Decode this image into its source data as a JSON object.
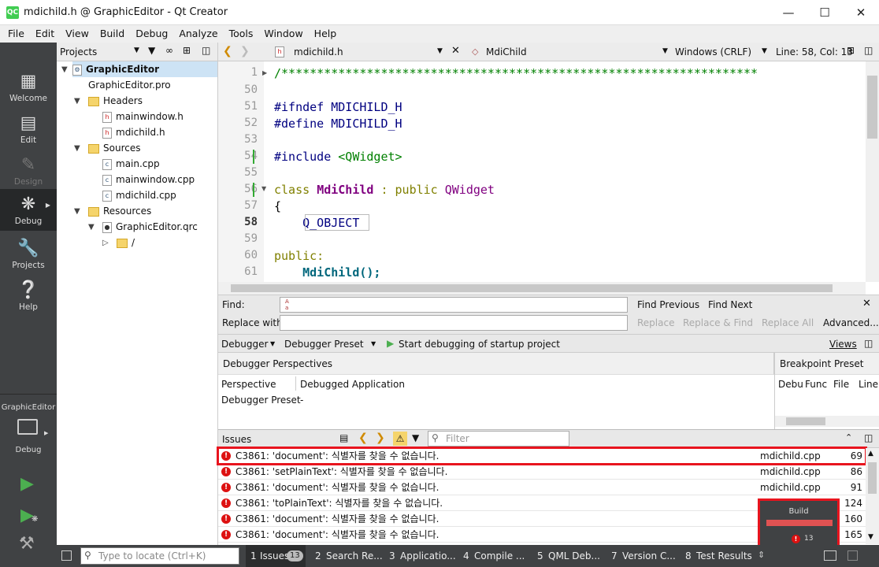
{
  "window": {
    "title": "mdichild.h @ GraphicEditor - Qt Creator",
    "app_icon": "QC"
  },
  "menu": [
    "File",
    "Edit",
    "View",
    "Build",
    "Debug",
    "Analyze",
    "Tools",
    "Window",
    "Help"
  ],
  "modes": [
    {
      "label": "Welcome",
      "icon": "grid-icon"
    },
    {
      "label": "Edit",
      "icon": "document-icon"
    },
    {
      "label": "Design",
      "icon": "pencil-icon"
    },
    {
      "label": "Debug",
      "icon": "bug-icon"
    },
    {
      "label": "Projects",
      "icon": "wrench-icon"
    },
    {
      "label": "Help",
      "icon": "help-icon"
    }
  ],
  "kit": {
    "project": "GraphicEditor",
    "config": "Debug"
  },
  "projects": {
    "header": "Projects",
    "tree": [
      {
        "label": "GraphicEditor"
      },
      {
        "label": "GraphicEditor.pro"
      },
      {
        "label": "Headers"
      },
      {
        "label": "mainwindow.h"
      },
      {
        "label": "mdichild.h"
      },
      {
        "label": "Sources"
      },
      {
        "label": "main.cpp"
      },
      {
        "label": "mainwindow.cpp"
      },
      {
        "label": "mdichild.cpp"
      },
      {
        "label": "Resources"
      },
      {
        "label": "GraphicEditor.qrc"
      },
      {
        "label": "/"
      }
    ]
  },
  "editor": {
    "file": "mdichild.h",
    "symbol": "MdiChild",
    "encoding": "Windows (CRLF)",
    "position": "Line: 58, Col: 13",
    "lines": [
      {
        "n": "1",
        "text": "/*******************************************************************"
      },
      {
        "n": "50",
        "text": ""
      },
      {
        "n": "51",
        "text": "#ifndef MDICHILD_H"
      },
      {
        "n": "52",
        "text": "#define MDICHILD_H"
      },
      {
        "n": "53",
        "text": ""
      },
      {
        "n": "54",
        "text": "#include <QWidget>"
      },
      {
        "n": "55",
        "text": ""
      },
      {
        "n": "56",
        "text": "class MdiChild : public QWidget"
      },
      {
        "n": "57",
        "text": "{"
      },
      {
        "n": "58",
        "text": "    Q_OBJECT"
      },
      {
        "n": "59",
        "text": ""
      },
      {
        "n": "60",
        "text": "public:"
      },
      {
        "n": "61",
        "text": "    MdiChild();"
      }
    ]
  },
  "find": {
    "find_label": "Find:",
    "replace_label": "Replace with:",
    "find_previous": "Find Previous",
    "find_next": "Find Next",
    "replace": "Replace",
    "replace_find": "Replace & Find",
    "replace_all": "Replace All",
    "advanced": "Advanced...",
    "case_icon": "Aa"
  },
  "debugger": {
    "combo1": "Debugger",
    "combo2": "Debugger Preset",
    "start": "Start debugging of startup project",
    "views": "Views",
    "perspectives_title": "Debugger Perspectives",
    "col_perspective": "Perspective",
    "col_app": "Debugged Application",
    "row_preset": "Debugger Preset",
    "row_dash": "-",
    "breakpoint_title": "Breakpoint Preset",
    "bp_cols": [
      "Debu",
      "Func",
      "File",
      "Line"
    ]
  },
  "issues": {
    "title": "Issues",
    "filter_placeholder": "Filter",
    "rows": [
      {
        "msg": "C3861: 'document': 식별자를 찾을 수 없습니다.",
        "file": "mdichild.cpp",
        "line": "69"
      },
      {
        "msg": "C3861: 'setPlainText': 식별자를 찾을 수 없습니다.",
        "file": "mdichild.cpp",
        "line": "86"
      },
      {
        "msg": "C3861: 'document': 식별자를 찾을 수 없습니다.",
        "file": "mdichild.cpp",
        "line": "91"
      },
      {
        "msg": "C3861: 'toPlainText': 식별자를 찾을 수 없습니다.",
        "file": "",
        "line": "124"
      },
      {
        "msg": "C3861: 'document': 식별자를 찾을 수 없습니다.",
        "file": "",
        "line": "160"
      },
      {
        "msg": "C3861: 'document': 식별자를 찾을 수 없습니다.",
        "file": "",
        "line": "165"
      }
    ]
  },
  "build_popup": {
    "title": "Build",
    "count": "13"
  },
  "statusbar": {
    "locator_placeholder": "Type to locate (Ctrl+K)",
    "tabs": [
      {
        "num": "1",
        "label": "Issues",
        "badge": "13"
      },
      {
        "num": "2",
        "label": "Search Re..."
      },
      {
        "num": "3",
        "label": "Applicatio..."
      },
      {
        "num": "4",
        "label": "Compile ..."
      },
      {
        "num": "5",
        "label": "QML Deb..."
      },
      {
        "num": "7",
        "label": "Version C..."
      },
      {
        "num": "8",
        "label": "Test Results"
      }
    ]
  }
}
